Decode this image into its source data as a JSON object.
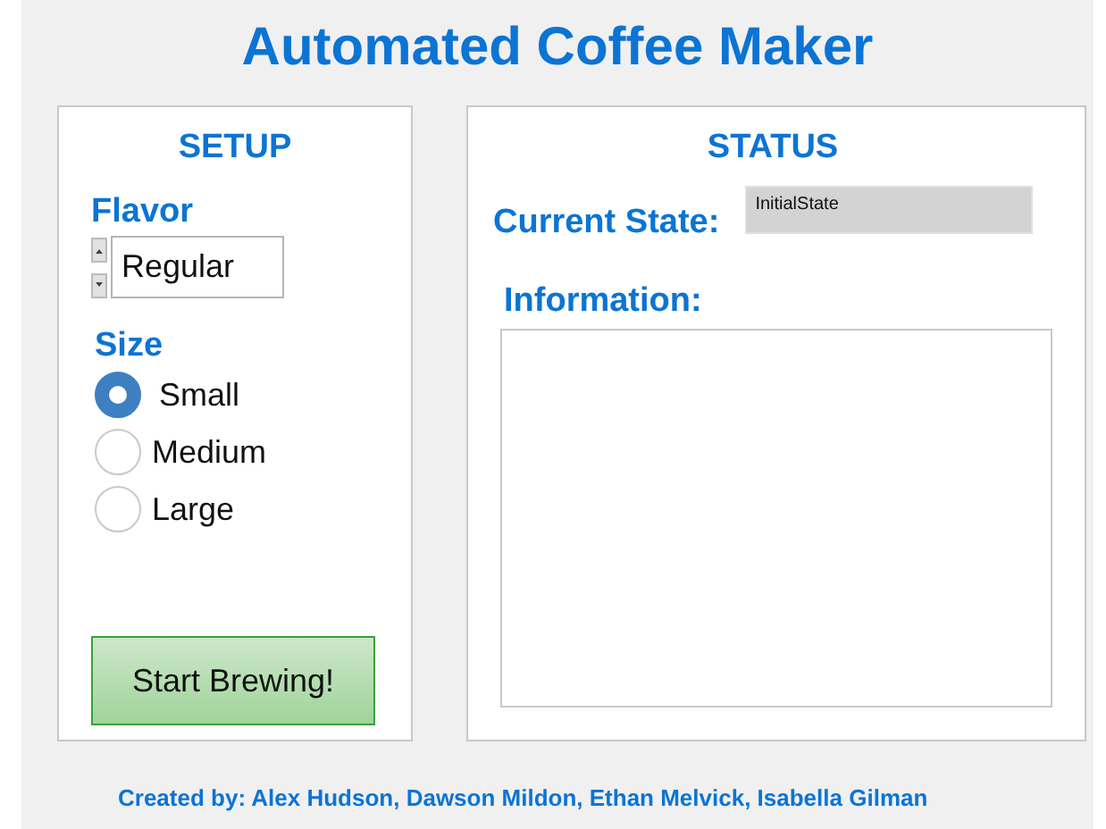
{
  "window": {
    "title": "Automated Coffee Maker"
  },
  "setup": {
    "heading": "SETUP",
    "flavor_label": "Flavor",
    "flavor_value": "Regular",
    "size_label": "Size",
    "sizes": [
      {
        "label": "Small",
        "selected": true
      },
      {
        "label": "Medium",
        "selected": false
      },
      {
        "label": "Large",
        "selected": false
      }
    ],
    "start_button": "Start Brewing!"
  },
  "status": {
    "heading": "STATUS",
    "current_state_label": "Current State:",
    "current_state_value": "InitialState",
    "information_label": "Information:"
  },
  "footer": "Created by: Alex Hudson, Dawson Mildon, Ethan Melvick, Isabella Gilman"
}
